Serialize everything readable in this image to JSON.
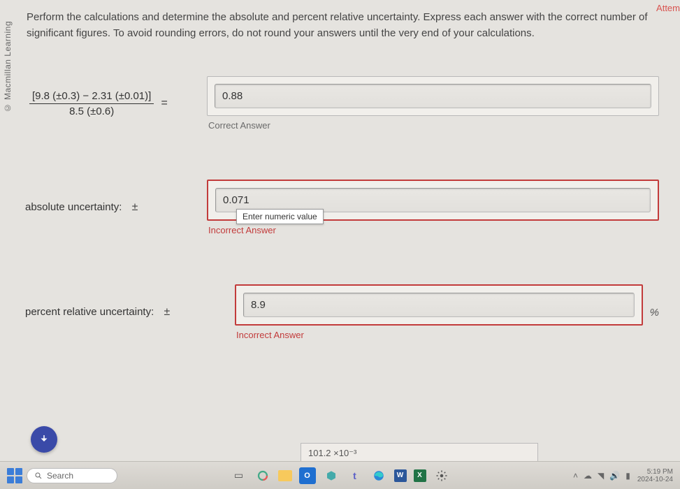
{
  "header": {
    "attem": "Attem",
    "copyright": "© Macmillan Learning"
  },
  "instructions": "Perform the calculations and determine the absolute and percent relative uncertainty. Express each answer with the correct number of significant figures. To avoid rounding errors, do not round your answers until the very end of your calculations.",
  "question1": {
    "numerator": "[9.8 (±0.3) − 2.31 (±0.01)]",
    "denominator": "8.5 (±0.6)",
    "equals": "=",
    "value": "0.88",
    "feedback": "Correct Answer"
  },
  "question2": {
    "label": "absolute uncertainty:",
    "pm": "±",
    "value": "0.071",
    "tooltip": "Enter numeric value",
    "feedback": "Incorrect Answer"
  },
  "question3": {
    "label": "percent relative uncertainty:",
    "pm": "±",
    "value": "8.9",
    "unit": "%",
    "feedback": "Incorrect Answer"
  },
  "peek": "101.2 ×10⁻³",
  "taskbar": {
    "search_placeholder": "Search",
    "time": "5:19 PM",
    "date": "2024-10-24"
  }
}
